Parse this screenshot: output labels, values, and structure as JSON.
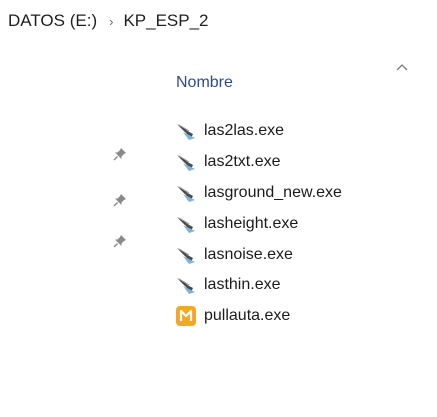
{
  "breadcrumb": {
    "drive": "DATOS (E:)",
    "separator": "›",
    "folder": "KP_ESP_2"
  },
  "column_header": {
    "label": "Nombre",
    "sort": "ascending"
  },
  "pins": {
    "count": 3,
    "icon": "pin-icon"
  },
  "files": [
    {
      "name": "las2las.exe",
      "icon": "lastools-exe-icon"
    },
    {
      "name": "las2txt.exe",
      "icon": "lastools-exe-icon"
    },
    {
      "name": "lasground_new.exe",
      "icon": "lastools-exe-icon"
    },
    {
      "name": "lasheight.exe",
      "icon": "lastools-exe-icon"
    },
    {
      "name": "lasnoise.exe",
      "icon": "lastools-exe-icon"
    },
    {
      "name": "lasthin.exe",
      "icon": "lastools-exe-icon"
    },
    {
      "name": "pullauta.exe",
      "icon": "pullauta-exe-icon"
    }
  ],
  "colors": {
    "header_text": "#2f4b8a",
    "pullauta_icon": "#f5a623"
  }
}
